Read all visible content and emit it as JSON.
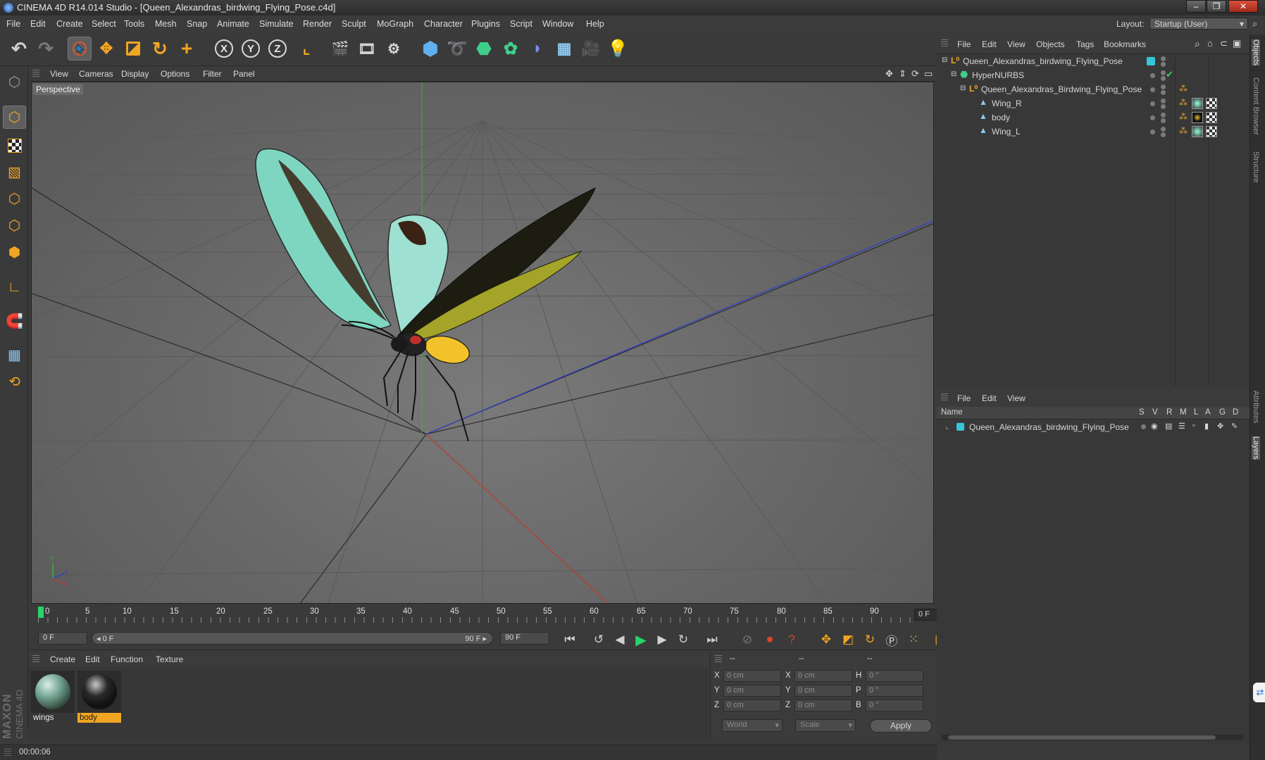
{
  "window": {
    "title": "CINEMA 4D R14.014 Studio - [Queen_Alexandras_birdwing_Flying_Pose.c4d]",
    "minimize": "–",
    "restore": "❐",
    "close": "✕"
  },
  "menubar": {
    "items": [
      "File",
      "Edit",
      "Create",
      "Select",
      "Tools",
      "Mesh",
      "Snap",
      "Animate",
      "Simulate",
      "Render",
      "Sculpt",
      "MoGraph",
      "Character",
      "Plugins",
      "Script",
      "Window",
      "Help"
    ],
    "layout_label": "Layout:",
    "layout_value": "Startup (User)"
  },
  "toolbar": {
    "undo": "↶",
    "redo": "↷",
    "axis_x": "X",
    "axis_y": "Y",
    "axis_z": "Z"
  },
  "viewport": {
    "menu": [
      "View",
      "Cameras",
      "Display",
      "Options",
      "Filter",
      "Panel"
    ],
    "label": "Perspective",
    "axis_y": "y",
    "axis_z": "z",
    "axis_x": "x"
  },
  "timeline": {
    "ticks": [
      "0",
      "5",
      "10",
      "15",
      "20",
      "25",
      "30",
      "35",
      "40",
      "45",
      "50",
      "55",
      "60",
      "65",
      "70",
      "75",
      "80",
      "85",
      "90"
    ],
    "current_frame_box": "0 F",
    "start_field": "0 F",
    "range_start": "◂ 0 F",
    "range_end": "90 F ▸",
    "end_field": "90 F"
  },
  "materials": {
    "menu": [
      "Create",
      "Edit",
      "Function",
      "Texture"
    ],
    "items": [
      {
        "name": "wings"
      },
      {
        "name": "body"
      }
    ]
  },
  "coordinates": {
    "header": [
      "--",
      "--",
      "--"
    ],
    "rows": [
      {
        "axis": "X",
        "pos": "0 cm",
        "axis2": "X",
        "size": "0 cm",
        "rot_label": "H",
        "rot": "0 °"
      },
      {
        "axis": "Y",
        "pos": "0 cm",
        "axis2": "Y",
        "size": "0 cm",
        "rot_label": "P",
        "rot": "0 °"
      },
      {
        "axis": "Z",
        "pos": "0 cm",
        "axis2": "Z",
        "size": "0 cm",
        "rot_label": "B",
        "rot": "0 °"
      }
    ],
    "space_select": "World",
    "mode_select": "Scale",
    "apply": "Apply"
  },
  "status": {
    "time": "00:00:06"
  },
  "logo": {
    "line1": "MAXON",
    "line2": "CINEMA 4D"
  },
  "object_manager": {
    "menu": [
      "File",
      "Edit",
      "View",
      "Objects",
      "Tags",
      "Bookmarks"
    ],
    "rows": [
      {
        "name": "Queen_Alexandras_birdwing_Flying_Pose"
      },
      {
        "name": "HyperNURBS"
      },
      {
        "name": "Queen_Alexandras_Birdwing_Flying_Pose"
      },
      {
        "name": "Wing_R"
      },
      {
        "name": "body"
      },
      {
        "name": "Wing_L"
      }
    ]
  },
  "layer_manager": {
    "menu": [
      "File",
      "Edit",
      "View"
    ],
    "columns": [
      "Name",
      "S",
      "V",
      "R",
      "M",
      "L",
      "A",
      "G",
      "D"
    ],
    "rows": [
      {
        "name": "Queen_Alexandras_birdwing_Flying_Pose"
      }
    ]
  },
  "side_tabs": [
    "Objects",
    "Content Browser",
    "Structure",
    "Attributes",
    "Layers"
  ],
  "colors": {
    "accent_cyan": "#35c6d8",
    "selection_orange": "#f0a623",
    "axis_red": "#c0392b",
    "axis_green": "#3fae3f",
    "axis_blue": "#2e3fd0"
  }
}
